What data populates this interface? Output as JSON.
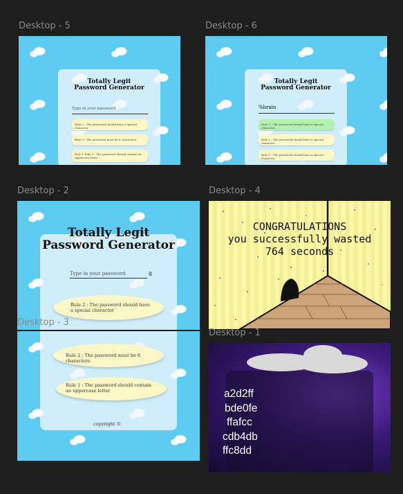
{
  "frames": {
    "d5": {
      "label": "Desktop - 5",
      "title_line1": "Totally Legit",
      "title_line2": "Password Generator",
      "placeholder": "Type in your password",
      "rules": [
        "Rule 2 : The password should have a special character",
        "Rule 0 : The password must be 8 characters",
        "Rule 1 Rule 1 : The password should contain an uppercase letter"
      ]
    },
    "d6": {
      "label": "Desktop - 6",
      "title_line1": "Totally Legit",
      "title_line2": "Password Generator",
      "value": "%brain",
      "rules": [
        "Rule 3 : The password should have a special character",
        "Rule 2 : The password should have a special character",
        "Rule 1 : The password should have a special character"
      ]
    },
    "d2": {
      "label": "Desktop - 2",
      "title_line1": "Totally Legit",
      "title_line2": "Password Generator",
      "placeholder": "Type in your password",
      "count": "0",
      "rule": "Rule 2 : The password should have a special character"
    },
    "d3": {
      "label": "Desktop - 3",
      "rules": [
        "Rule 2 : The password must be 8 characters",
        "Rule 1 : The password should contain an uppercase letter"
      ],
      "footer": "copyright ©"
    },
    "d4": {
      "label": "Desktop - 4",
      "line1": "CONGRATULATIONS",
      "line2": "you successfully wasted",
      "line3": "764 seconds"
    },
    "d1": {
      "label": "Desktop - 1",
      "colors": [
        "a2d2ff",
        "bde0fe",
        "ffafcc",
        "cdb4db",
        "ffc8dd"
      ]
    }
  },
  "colors": {
    "canvas": "#1e1e1e",
    "sky": "#5ecbf0",
    "rule_note": "#fbf7c6",
    "rule_pass": "#b4f0b0",
    "frame_label": "#8a8a8a"
  }
}
